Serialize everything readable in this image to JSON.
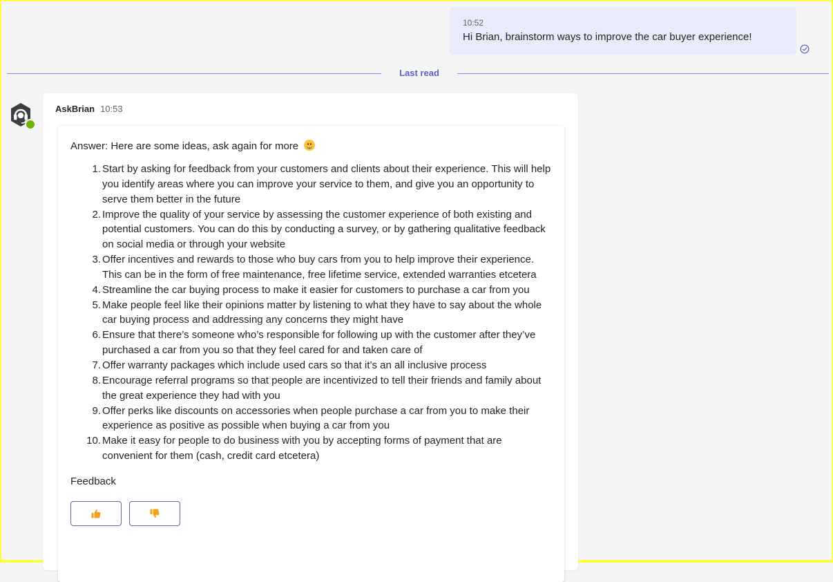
{
  "outgoing": {
    "time": "10:52",
    "text": "Hi Brian, brainstorm ways to improve the car buyer experience!",
    "receipt_icon": "read-check-icon"
  },
  "divider": {
    "label": "Last read"
  },
  "incoming": {
    "sender": "AskBrian",
    "time": "10:53",
    "avatar_icon": "headset-bot-icon",
    "presence": "available",
    "card": {
      "answer_intro": "Answer: Here are some ideas, ask again for more",
      "answer_emoji": "smile-emoji-icon",
      "ideas": [
        {
          "num": "1.",
          "text": "Start by asking for feedback from your customers and clients about their experience. This will help you identify areas where you can improve your service to them, and give you an opportunity to serve them better in the future"
        },
        {
          "num": "2.",
          "text": "Improve the quality of your service by assessing the customer experience of both existing and potential customers. You can do this by conducting a survey, or by gathering qualitative feedback on social media or through your website"
        },
        {
          "num": "3.",
          "text": "Offer incentives and rewards to those who buy cars from you to help improve their experience. This can be in the form of free maintenance, free lifetime service, extended warranties etcetera"
        },
        {
          "num": "4.",
          "text": "Streamline the car buying process to make it easier for customers to purchase a car from you"
        },
        {
          "num": "5.",
          "text": "Make people feel like their opinions matter by listening to what they have to say about the whole car buying process and addressing any concerns they might have"
        },
        {
          "num": "6.",
          "text": "Ensure that there’s someone who’s responsible for following up with the customer after they’ve purchased a car from you so that they feel cared for and taken care of"
        },
        {
          "num": "7.",
          "text": "Offer warranty packages which include used cars so that it’s an all inclusive process"
        },
        {
          "num": "8.",
          "text": "Encourage referral programs so that people are incentivized to tell their friends and family about the great experience they had with you"
        },
        {
          "num": "9.",
          "text": "Offer perks like discounts on accessories when people purchase a car from you to make their experience as positive as possible when buying a car from you"
        },
        {
          "num": "10.",
          "text": "Make it easy for people to do business with you by accepting forms of payment that are convenient for them (cash, credit card etcetera)"
        }
      ],
      "feedback_label": "Feedback",
      "feedback_buttons": [
        {
          "icon": "thumbs-up-icon"
        },
        {
          "icon": "thumbs-down-icon"
        }
      ]
    }
  },
  "colors": {
    "outgoing_bubble": "#e8ebfa",
    "divider": "#7f85f5",
    "divider_text": "#5b5fc7",
    "button_border": "#6264a7",
    "thumb": "#f2a11a",
    "presence": "#6bb700",
    "frame": "#fdfd44"
  }
}
